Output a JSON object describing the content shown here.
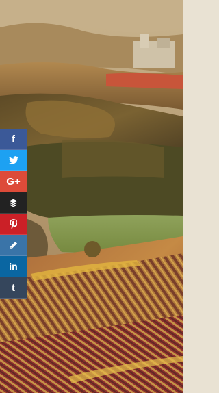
{
  "share_bar": {
    "buttons": [
      {
        "network": "facebook",
        "icon": "facebook-icon",
        "glyph": "f",
        "color": "#3B5998"
      },
      {
        "network": "twitter",
        "icon": "twitter-icon",
        "glyph": "",
        "color": "#1DA1F2"
      },
      {
        "network": "google-plus",
        "icon": "google-plus-icon",
        "glyph": "G+",
        "color": "#DD4B39"
      },
      {
        "network": "buffer",
        "icon": "buffer-icon",
        "glyph": "",
        "color": "#222222"
      },
      {
        "network": "pinterest",
        "icon": "pinterest-icon",
        "glyph": "P",
        "color": "#CB2027"
      },
      {
        "network": "edit",
        "icon": "pencil-icon",
        "glyph": "",
        "color": "#3A74A8"
      },
      {
        "network": "linkedin",
        "icon": "linkedin-icon",
        "glyph": "in",
        "color": "#0A66A2"
      },
      {
        "network": "tumblr",
        "icon": "tumblr-icon",
        "glyph": "t",
        "color": "#35465C"
      }
    ]
  }
}
